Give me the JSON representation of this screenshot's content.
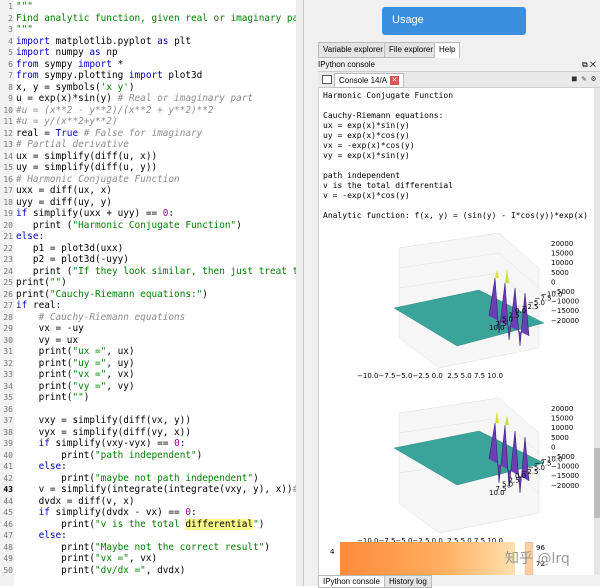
{
  "editor": {
    "lines": [
      {
        "n": "1",
        "parts": [
          [
            "st",
            "\"\"\""
          ]
        ]
      },
      {
        "n": "2",
        "parts": [
          [
            "st",
            "Find analytic function, given real or imaginary part"
          ]
        ]
      },
      {
        "n": "3",
        "parts": [
          [
            "st",
            "\"\"\""
          ]
        ]
      },
      {
        "n": "4",
        "parts": [
          [
            "kw",
            "import"
          ],
          [
            "df",
            " matplotlib.pyplot "
          ],
          [
            "kw",
            "as"
          ],
          [
            "df",
            " plt"
          ]
        ]
      },
      {
        "n": "5",
        "parts": [
          [
            "kw",
            "import"
          ],
          [
            "df",
            " numpy "
          ],
          [
            "kw",
            "as"
          ],
          [
            "df",
            " np"
          ]
        ]
      },
      {
        "n": "6",
        "parts": [
          [
            "kw",
            "from"
          ],
          [
            "df",
            " sympy "
          ],
          [
            "kw",
            "import"
          ],
          [
            "df",
            " *"
          ]
        ]
      },
      {
        "n": "7",
        "parts": [
          [
            "kw",
            "from"
          ],
          [
            "df",
            " sympy.plotting "
          ],
          [
            "kw",
            "import"
          ],
          [
            "df",
            " plot3d"
          ]
        ]
      },
      {
        "n": "8",
        "parts": [
          [
            "df",
            "x, y = symbols("
          ],
          [
            "st",
            "'x y'"
          ],
          [
            "df",
            ")"
          ]
        ]
      },
      {
        "n": "9",
        "parts": [
          [
            "df",
            "u = exp(x)*sin(y) "
          ],
          [
            "cm",
            "# Real or imaginary part"
          ]
        ]
      },
      {
        "n": "10",
        "parts": [
          [
            "cm",
            "#u = (x**2 - y**2)/(x**2 + y**2)**2"
          ]
        ]
      },
      {
        "n": "11",
        "parts": [
          [
            "cm",
            "#u = y/(x**2+y**2)"
          ]
        ]
      },
      {
        "n": "12",
        "parts": [
          [
            "df",
            "real = "
          ],
          [
            "kw",
            "True"
          ],
          [
            "df",
            " "
          ],
          [
            "cm",
            "# False for imaginary"
          ]
        ]
      },
      {
        "n": "13",
        "parts": [
          [
            "cm",
            "# Partial derivative"
          ]
        ]
      },
      {
        "n": "14",
        "parts": [
          [
            "df",
            "ux = simplify(diff(u, x))"
          ]
        ]
      },
      {
        "n": "15",
        "parts": [
          [
            "df",
            "uy = simplify(diff(u, y))"
          ]
        ]
      },
      {
        "n": "16",
        "parts": [
          [
            "cm",
            "# Harmonic Conjugate Function"
          ]
        ]
      },
      {
        "n": "17",
        "parts": [
          [
            "df",
            "uxx = diff(ux, x)"
          ]
        ]
      },
      {
        "n": "18",
        "parts": [
          [
            "df",
            "uyy = diff(uy, y)"
          ]
        ]
      },
      {
        "n": "19",
        "parts": [
          [
            "kw",
            "if"
          ],
          [
            "df",
            " simplify(uxx + uyy) == "
          ],
          [
            "nu",
            "0"
          ],
          [
            "df",
            ":"
          ]
        ]
      },
      {
        "n": "20",
        "parts": [
          [
            "df",
            "   print ("
          ],
          [
            "st",
            "\"Harmonic Conjugate Function\""
          ],
          [
            "df",
            ")"
          ]
        ]
      },
      {
        "n": "21",
        "parts": [
          [
            "kw",
            "else"
          ],
          [
            "df",
            ":"
          ]
        ]
      },
      {
        "n": "22",
        "parts": [
          [
            "df",
            "   p1 = plot3d(uxx)"
          ]
        ]
      },
      {
        "n": "23",
        "parts": [
          [
            "df",
            "   p2 = plot3d(-uyy)"
          ]
        ]
      },
      {
        "n": "24",
        "parts": [
          [
            "df",
            "   print ("
          ],
          [
            "st",
            "\"If they look similar, then just treat them a"
          ]
        ]
      },
      {
        "n": "25",
        "parts": [
          [
            "df",
            "print("
          ],
          [
            "st",
            "\"\""
          ],
          [
            "df",
            ")"
          ]
        ]
      },
      {
        "n": "26",
        "parts": [
          [
            "df",
            "print("
          ],
          [
            "st",
            "\"Cauchy-Riemann equations:\""
          ],
          [
            "df",
            ")"
          ]
        ]
      },
      {
        "n": "27",
        "parts": [
          [
            "kw",
            "if"
          ],
          [
            "df",
            " real:"
          ]
        ]
      },
      {
        "n": "28",
        "parts": [
          [
            "df",
            "    "
          ],
          [
            "cm",
            "# Cauchy-Riemann equations"
          ]
        ]
      },
      {
        "n": "29",
        "parts": [
          [
            "df",
            "    vx = -uy"
          ]
        ]
      },
      {
        "n": "30",
        "parts": [
          [
            "df",
            "    vy = ux"
          ]
        ]
      },
      {
        "n": "31",
        "parts": [
          [
            "df",
            "    print("
          ],
          [
            "st",
            "\"ux =\""
          ],
          [
            "df",
            ", ux)"
          ]
        ]
      },
      {
        "n": "32",
        "parts": [
          [
            "df",
            "    print("
          ],
          [
            "st",
            "\"uy =\""
          ],
          [
            "df",
            ", uy)"
          ]
        ]
      },
      {
        "n": "33",
        "parts": [
          [
            "df",
            "    print("
          ],
          [
            "st",
            "\"vx =\""
          ],
          [
            "df",
            ", vx)"
          ]
        ]
      },
      {
        "n": "34",
        "parts": [
          [
            "df",
            "    print("
          ],
          [
            "st",
            "\"vy =\""
          ],
          [
            "df",
            ", vy)"
          ]
        ]
      },
      {
        "n": "35",
        "parts": [
          [
            "df",
            "    print("
          ],
          [
            "st",
            "\"\""
          ],
          [
            "df",
            ")"
          ]
        ]
      },
      {
        "n": "36",
        "parts": [
          [
            "df",
            ""
          ]
        ]
      },
      {
        "n": "37",
        "parts": [
          [
            "df",
            "    vxy = simplify(diff(vx, y))"
          ]
        ]
      },
      {
        "n": "38",
        "parts": [
          [
            "df",
            "    vyx = simplify(diff(vy, x))"
          ]
        ]
      },
      {
        "n": "39",
        "parts": [
          [
            "df",
            "    "
          ],
          [
            "kw",
            "if"
          ],
          [
            "df",
            " simplify(vxy-vyx) == "
          ],
          [
            "nu",
            "0"
          ],
          [
            "df",
            ":"
          ]
        ]
      },
      {
        "n": "40",
        "parts": [
          [
            "df",
            "        print("
          ],
          [
            "st",
            "\"path independent\""
          ],
          [
            "df",
            ")"
          ]
        ]
      },
      {
        "n": "41",
        "parts": [
          [
            "df",
            "    "
          ],
          [
            "kw",
            "else"
          ],
          [
            "df",
            ":"
          ]
        ]
      },
      {
        "n": "42",
        "parts": [
          [
            "df",
            "        print("
          ],
          [
            "st",
            "\"maybe not path independent\""
          ],
          [
            "df",
            ")"
          ]
        ]
      },
      {
        "n": "43",
        "cur": true,
        "parts": [
          [
            "df",
            "    v = simplify(integrate(integrate(vxy, y), x))"
          ],
          [
            "cm",
            "#Integ"
          ]
        ]
      },
      {
        "n": "44",
        "parts": [
          [
            "df",
            "    dvdx = diff(v, x)"
          ]
        ]
      },
      {
        "n": "45",
        "parts": [
          [
            "df",
            "    "
          ],
          [
            "kw",
            "if"
          ],
          [
            "df",
            " simplify(dvdx - vx) == "
          ],
          [
            "nu",
            "0"
          ],
          [
            "df",
            ":"
          ]
        ]
      },
      {
        "n": "46",
        "parts": [
          [
            "df",
            "        print("
          ],
          [
            "st",
            "\"v is the total "
          ],
          [
            "hl",
            "differential"
          ],
          [
            "st",
            "\""
          ],
          [
            "df",
            ")"
          ]
        ]
      },
      {
        "n": "47",
        "parts": [
          [
            "df",
            "    "
          ],
          [
            "kw",
            "else"
          ],
          [
            "df",
            ":"
          ]
        ]
      },
      {
        "n": "48",
        "parts": [
          [
            "df",
            "        print("
          ],
          [
            "st",
            "\"Maybe not the correct result\""
          ],
          [
            "df",
            ")"
          ]
        ]
      },
      {
        "n": "49",
        "parts": [
          [
            "df",
            "        print("
          ],
          [
            "st",
            "\"vx =\""
          ],
          [
            "df",
            ", vx)"
          ]
        ]
      },
      {
        "n": "50",
        "parts": [
          [
            "df",
            "        print("
          ],
          [
            "st",
            "\"dv/dx =\""
          ],
          [
            "df",
            ", dvdx)"
          ]
        ]
      }
    ]
  },
  "help_panel": {
    "usage_label": "Usage"
  },
  "top_tabs": [
    "Variable explorer",
    "File explorer",
    "Help"
  ],
  "panel_title": "IPython console",
  "console_tab": "Console 14/A",
  "console_output": [
    "Harmonic Conjugate Function",
    "",
    "Cauchy-Riemann equations:",
    "ux = exp(x)*sin(y)",
    "uy = exp(x)*cos(y)",
    "vx = -exp(x)*cos(y)",
    "vy = exp(x)*sin(y)",
    "",
    "path independent",
    "v is the total differential",
    "v = -exp(x)*cos(y)",
    "",
    "Analytic function: f(x, y) = (sin(y) - I*cos(y))*exp(x)"
  ],
  "plot1": {
    "z_ticks": [
      "20000",
      "15000",
      "10000",
      "5000",
      "0",
      "−5000",
      "−10000",
      "−15000",
      "−20000"
    ],
    "x_ticks": "−10.0−7.5−5.0−2.5 0.0  2.5 5.0 7.5 10.0",
    "y_ticks": [
      "10.0",
      "7.5",
      "5.0",
      "2.5",
      "0.0",
      "−2.5",
      "−5.0",
      "−7.5",
      "−10.0"
    ]
  },
  "plot2": {
    "z_ticks": [
      "20000",
      "15000",
      "10000",
      "5000",
      "0",
      "−5000",
      "−10000",
      "−15000",
      "−20000"
    ],
    "x_ticks": "−10.0−7.5−5.0−2.5 0.0  2.5 5.0 7.5 10.0",
    "y_ticks": [
      "10.0",
      "7.5",
      "5.0",
      "2.5",
      "0.0",
      "−2.5",
      "−5.0",
      "−7.5",
      "−10.0"
    ]
  },
  "plot3": {
    "y_tick": "4",
    "cbar_ticks": [
      "96",
      "72"
    ]
  },
  "bottom_tabs": [
    "IPython console",
    "History log"
  ],
  "watermark": "知乎 @lrq",
  "colors": {
    "surface": "#3aa39a",
    "accent": "#3b8fdf"
  }
}
